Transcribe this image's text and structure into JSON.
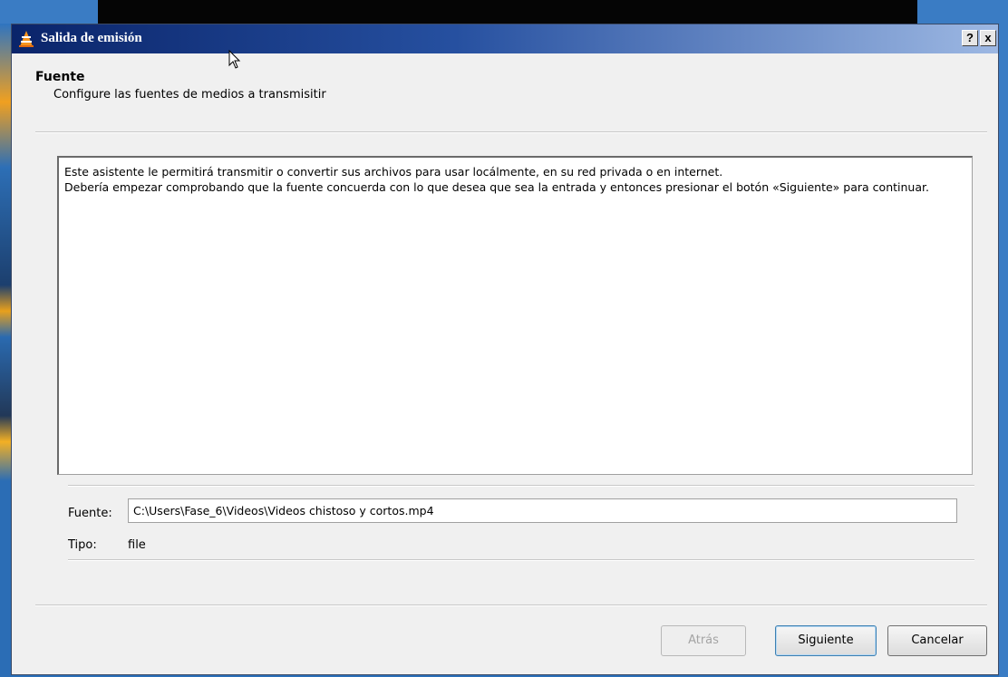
{
  "window": {
    "title": "Salida de emisión",
    "help_button": "?",
    "close_button": "x"
  },
  "header": {
    "title": "Fuente",
    "subtitle": "Configure las fuentes de medios a transmisitir"
  },
  "info": {
    "line1": "Este asistente le permitirá transmitir o convertir sus archivos para usar locálmente, en su red privada o en internet.",
    "line2": "Debería empezar comprobando que la fuente concuerda con lo que desea que sea la entrada y entonces presionar el botón «Siguiente» para continuar."
  },
  "source": {
    "label": "Fuente:",
    "value": "C:\\Users\\Fase_6\\Videos\\Videos chistoso y cortos.mp4",
    "type_label": "Tipo:",
    "type_value": "file"
  },
  "buttons": {
    "back": "Atrás",
    "next": "Siguiente",
    "cancel": "Cancelar"
  },
  "colors": {
    "titlebar_start": "#0a246a",
    "titlebar_end": "#9db8e3",
    "dialog_bg": "#f0f0f0"
  },
  "icons": {
    "app": "vlc-cone-icon",
    "cursor": "mouse-cursor-icon"
  }
}
